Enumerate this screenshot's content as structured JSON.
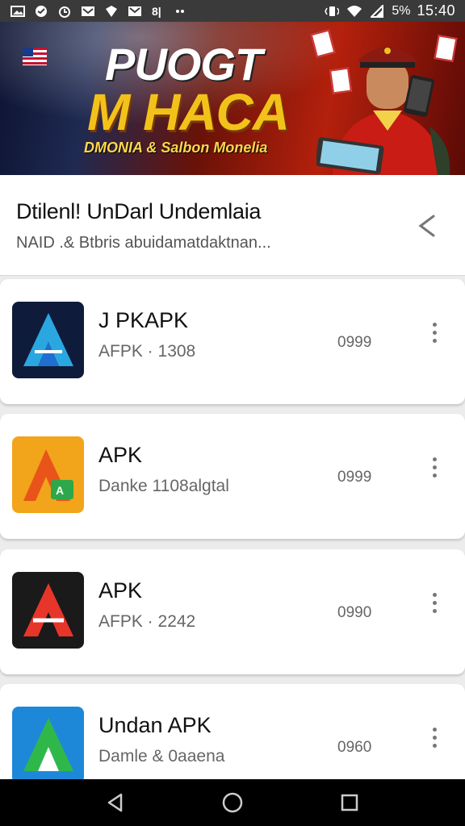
{
  "status_bar": {
    "time": "15:40",
    "battery": "5%",
    "left_icons": [
      "picture-icon",
      "chat-icon",
      "alarm-icon",
      "mail-icon",
      "shield-icon",
      "email-icon",
      "sim-icon",
      "more-dots-icon"
    ],
    "right_icons": [
      "vibrate-icon",
      "wifi-icon",
      "signal-icon"
    ]
  },
  "banner": {
    "line1": "PUOGT",
    "line2": "M HACA",
    "line3": "DMONIA & Salbon Monelia"
  },
  "header": {
    "title": "Dtilenl! UnDarl Undemlaia",
    "subtitle": "NAID .& Btbris abuidamatdaktnan...",
    "share_icon": "share-icon"
  },
  "apps": [
    {
      "name": "J PKAPK",
      "meta": "AFPK · 1308",
      "size": "0999",
      "icon_bg": "#0f1b3a",
      "icon_fg": "#2aa7e0",
      "icon_accent": "#1e6fd0"
    },
    {
      "name": "APK",
      "meta": "Danke 1108algtal",
      "size": "0999",
      "icon_bg": "#f2a41a",
      "icon_fg": "#e8541a",
      "icon_accent": "#2ca84a"
    },
    {
      "name": "APK",
      "meta": "AFPK · 2242",
      "size": "0990",
      "icon_bg": "#1a1a1a",
      "icon_fg": "#e8352a",
      "icon_accent": "#ffffff"
    },
    {
      "name": "Undan APK",
      "meta": "Damle & 0aaena",
      "size": "0960",
      "icon_bg": "#1e88d8",
      "icon_fg": "#2fb84a",
      "icon_accent": "#ffffff"
    }
  ],
  "nav_bar": {
    "icons": [
      "back-icon",
      "home-icon",
      "recents-icon"
    ]
  }
}
